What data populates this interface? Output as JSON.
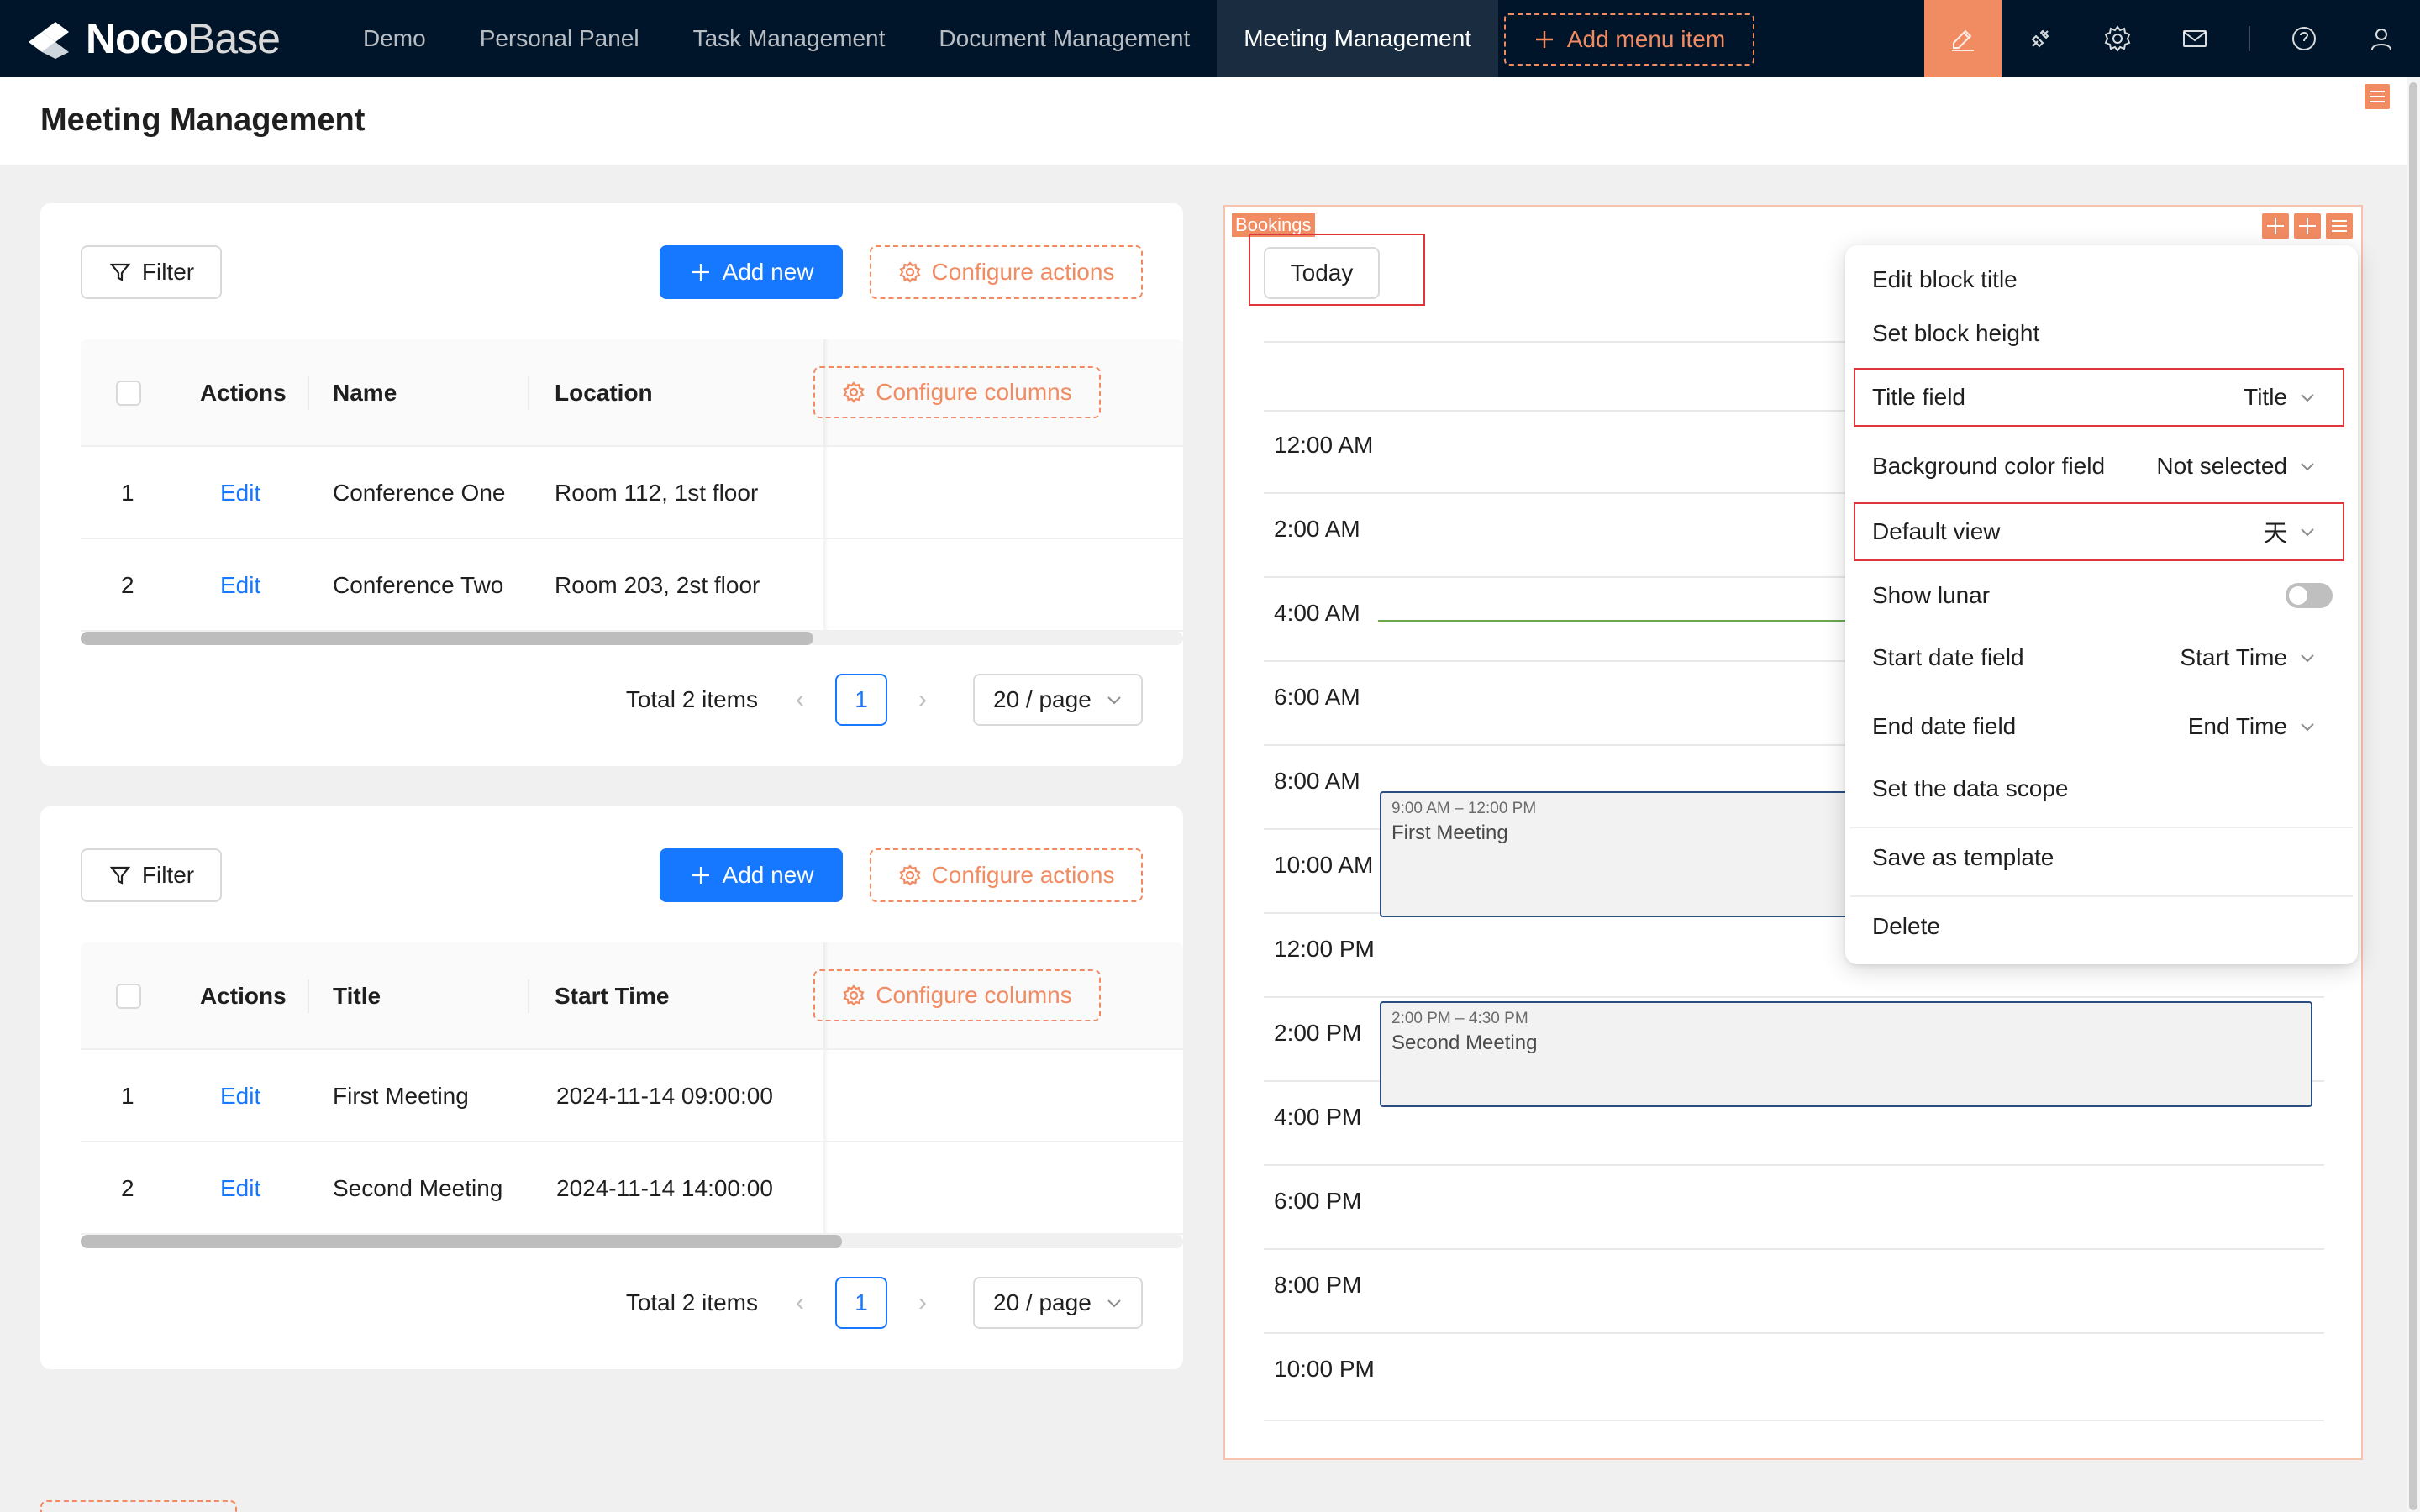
{
  "brand": {
    "name_bold": "Noco",
    "name_light": "Base"
  },
  "nav": {
    "items": [
      "Demo",
      "Personal Panel",
      "Task Management",
      "Document Management",
      "Meeting Management"
    ],
    "active_index": 4,
    "add_menu_label": "Add menu item",
    "tool_icons": [
      "ui-editor-icon",
      "plugin-icon",
      "settings-icon",
      "mail-icon",
      "help-icon",
      "user-icon"
    ]
  },
  "page": {
    "title": "Meeting Management"
  },
  "rooms_table": {
    "filter_label": "Filter",
    "add_new_label": "Add new",
    "configure_actions_label": "Configure actions",
    "configure_columns_label": "Configure columns",
    "columns": [
      "Actions",
      "Name",
      "Location"
    ],
    "rows": [
      {
        "index": "1",
        "action": "Edit",
        "name": "Conference One",
        "location": "Room 112, 1st floor"
      },
      {
        "index": "2",
        "action": "Edit",
        "name": "Conference Two",
        "location": "Room 203, 2st floor"
      }
    ],
    "pagination": {
      "total": "Total 2 items",
      "page": "1",
      "page_size": "20 / page"
    }
  },
  "meetings_table": {
    "filter_label": "Filter",
    "add_new_label": "Add new",
    "configure_actions_label": "Configure actions",
    "configure_columns_label": "Configure columns",
    "columns": [
      "Actions",
      "Title",
      "Start Time"
    ],
    "rows": [
      {
        "index": "1",
        "action": "Edit",
        "title": "First Meeting",
        "start": "2024-11-14 09:00:00"
      },
      {
        "index": "2",
        "action": "Edit",
        "title": "Second Meeting",
        "start": "2024-11-14 14:00:00"
      }
    ],
    "pagination": {
      "total": "Total 2 items",
      "page": "1",
      "page_size": "20 / page"
    }
  },
  "calendar": {
    "block_tag": "Bookings",
    "today_label": "Today",
    "time_slots": [
      "12:00 AM",
      "2:00 AM",
      "4:00 AM",
      "6:00 AM",
      "8:00 AM",
      "10:00 AM",
      "12:00 PM",
      "2:00 PM",
      "4:00 PM",
      "6:00 PM",
      "8:00 PM",
      "10:00 PM"
    ],
    "events": [
      {
        "time": "9:00 AM – 12:00 PM",
        "title": "First Meeting"
      },
      {
        "time": "2:00 PM – 4:30 PM",
        "title": "Second Meeting"
      }
    ]
  },
  "settings_menu": {
    "edit_block_title": "Edit block title",
    "set_block_height": "Set block height",
    "title_field": {
      "label": "Title field",
      "value": "Title"
    },
    "background_color_field": {
      "label": "Background color field",
      "value": "Not selected"
    },
    "default_view": {
      "label": "Default view",
      "value": "天"
    },
    "show_lunar": {
      "label": "Show lunar",
      "enabled": false
    },
    "start_date_field": {
      "label": "Start date field",
      "value": "Start Time"
    },
    "end_date_field": {
      "label": "End date field",
      "value": "End Time"
    },
    "set_data_scope": "Set the data scope",
    "save_as_template": "Save as template",
    "delete": "Delete"
  },
  "colors": {
    "nav_bg": "#001529",
    "accent": "#f18b62",
    "primary": "#1677ff",
    "highlight": "#e0353a"
  }
}
